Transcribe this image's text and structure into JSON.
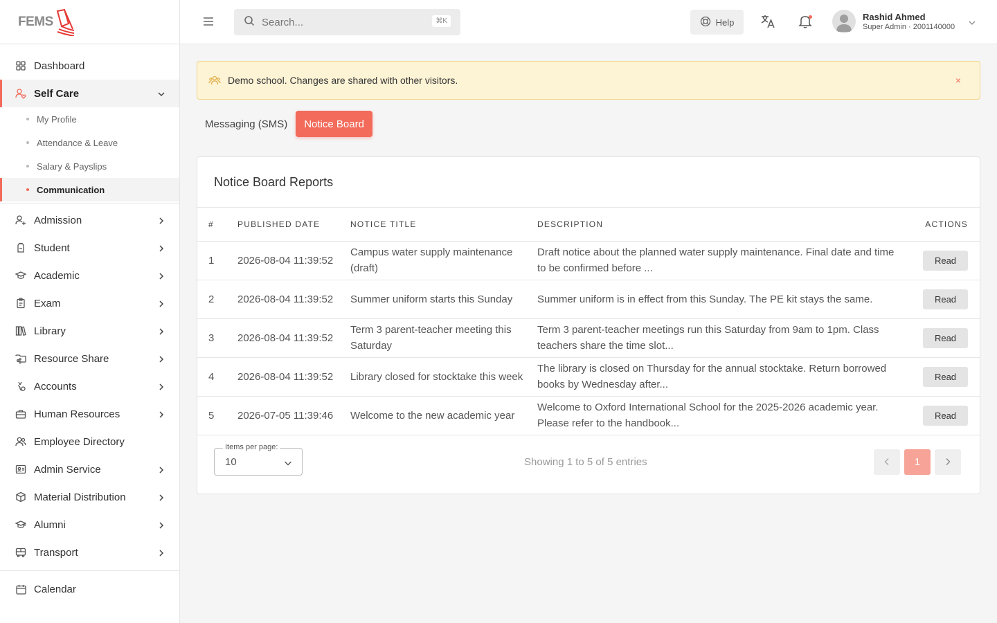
{
  "brand": {
    "logo_text": "FEMS",
    "accent": "#f26b5b"
  },
  "sidebar": {
    "top": [
      {
        "label": "Dashboard",
        "icon": "grid-icon"
      }
    ],
    "self_care": {
      "label": "Self Care",
      "icon": "user-heart-icon",
      "children": [
        "My Profile",
        "Attendance & Leave",
        "Salary & Payslips",
        "Communication"
      ],
      "active_child": "Communication"
    },
    "items": [
      {
        "label": "Admission",
        "icon": "user-plus-icon",
        "chevron": true
      },
      {
        "label": "Student",
        "icon": "backpack-icon",
        "chevron": true
      },
      {
        "label": "Academic",
        "icon": "mortarboard-icon",
        "chevron": true
      },
      {
        "label": "Exam",
        "icon": "clipboard-icon",
        "chevron": true
      },
      {
        "label": "Library",
        "icon": "books-icon",
        "chevron": true
      },
      {
        "label": "Resource Share",
        "icon": "folder-share-icon",
        "chevron": true
      },
      {
        "label": "Accounts",
        "icon": "money-icon",
        "chevron": true
      },
      {
        "label": "Human Resources",
        "icon": "briefcase-icon",
        "chevron": true
      },
      {
        "label": "Employee Directory",
        "icon": "users-icon",
        "chevron": false
      },
      {
        "label": "Admin Service",
        "icon": "id-card-icon",
        "chevron": true
      },
      {
        "label": "Material Distribution",
        "icon": "box-icon",
        "chevron": true
      },
      {
        "label": "Alumni",
        "icon": "graduation-icon",
        "chevron": true
      },
      {
        "label": "Transport",
        "icon": "bus-icon",
        "chevron": true
      }
    ],
    "bottom": [
      {
        "label": "Calendar",
        "icon": "calendar-icon"
      }
    ]
  },
  "topbar": {
    "search_placeholder": "Search...",
    "search_shortcut": "⌘K",
    "help_label": "Help",
    "user_name": "Rashid Ahmed",
    "user_role": "Super Admin · 2001140000"
  },
  "alert": {
    "message": "Demo school. Changes are shared with other visitors.",
    "close": "×"
  },
  "tabs": [
    {
      "label": "Messaging (SMS)",
      "active": false
    },
    {
      "label": "Notice Board",
      "active": true
    }
  ],
  "report": {
    "title": "Notice Board Reports",
    "columns": [
      "#",
      "Published Date",
      "Notice Title",
      "Description",
      "Actions"
    ],
    "rows": [
      {
        "n": "1",
        "date": "2026-08-04 11:39:52",
        "title": "Campus water supply maintenance (draft)",
        "desc": "Draft notice about the planned water supply maintenance. Final date and time to be confirmed before ...",
        "action": "Read"
      },
      {
        "n": "2",
        "date": "2026-08-04 11:39:52",
        "title": "Summer uniform starts this Sunday",
        "desc": "Summer uniform is in effect from this Sunday. The PE kit stays the same.",
        "action": "Read"
      },
      {
        "n": "3",
        "date": "2026-08-04 11:39:52",
        "title": "Term 3 parent-teacher meeting this Saturday",
        "desc": "Term 3 parent-teacher meetings run this Saturday from 9am to 1pm. Class teachers share the time slot...",
        "action": "Read"
      },
      {
        "n": "4",
        "date": "2026-08-04 11:39:52",
        "title": "Library closed for stocktake this week",
        "desc": "The library is closed on Thursday for the annual stocktake. Return borrowed books by Wednesday after...",
        "action": "Read"
      },
      {
        "n": "5",
        "date": "2026-07-05 11:39:46",
        "title": "Welcome to the new academic year",
        "desc": "Welcome to Oxford International School for the 2025-2026 academic year. Please refer to the handbook...",
        "action": "Read"
      }
    ],
    "items_per_page_label": "Items per page:",
    "items_per_page": "10",
    "showing": "Showing 1 to 5 of 5 entries",
    "current_page": "1"
  }
}
